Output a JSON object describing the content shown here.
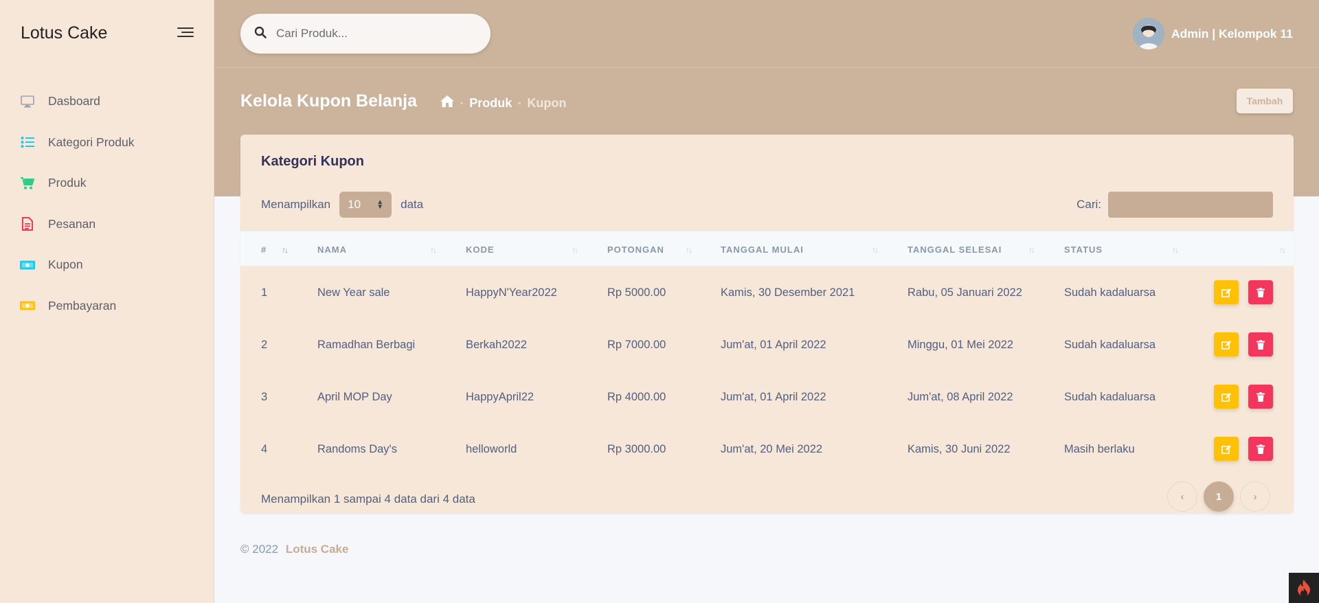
{
  "sidebar": {
    "brand": "Lotus Cake",
    "items": [
      {
        "label": "Dasboard",
        "icon": "monitor-icon",
        "color": "#8f9aa8"
      },
      {
        "label": "Kategori Produk",
        "icon": "list-icon",
        "color": "#11cdef"
      },
      {
        "label": "Produk",
        "icon": "cart-icon",
        "color": "#2dce89"
      },
      {
        "label": "Pesanan",
        "icon": "document-icon",
        "color": "#f5365c"
      },
      {
        "label": "Kupon",
        "icon": "money-icon",
        "color": "#11cdef"
      },
      {
        "label": "Pembayaran",
        "icon": "money-icon",
        "color": "#ffc107"
      }
    ]
  },
  "header": {
    "search_placeholder": "Cari Produk...",
    "user_name": "Admin | Kelompok 11",
    "page_title": "Kelola Kupon Belanja",
    "breadcrumb": [
      "Produk",
      "Kupon"
    ],
    "add_button": "Tambah"
  },
  "card": {
    "title": "Kategori Kupon",
    "show_prefix": "Menampilkan",
    "show_value": "10",
    "show_suffix": "data",
    "search_label": "Cari:",
    "columns": [
      "#",
      "NAMA",
      "KODE",
      "POTONGAN",
      "TANGGAL MULAI",
      "TANGGAL SELESAI",
      "STATUS"
    ],
    "rows": [
      {
        "no": "1",
        "nama": "New Year sale",
        "kode": "HappyN'Year2022",
        "potongan": "Rp 5000.00",
        "mulai": "Kamis, 30 Desember 2021",
        "selesai": "Rabu, 05 Januari 2022",
        "status": "Sudah kadaluarsa"
      },
      {
        "no": "2",
        "nama": "Ramadhan Berbagi",
        "kode": "Berkah2022",
        "potongan": "Rp 7000.00",
        "mulai": "Jum'at, 01 April 2022",
        "selesai": "Minggu, 01 Mei 2022",
        "status": "Sudah kadaluarsa"
      },
      {
        "no": "3",
        "nama": "April MOP Day",
        "kode": "HappyApril22",
        "potongan": "Rp 4000.00",
        "mulai": "Jum'at, 01 April 2022",
        "selesai": "Jum'at, 08 April 2022",
        "status": "Sudah kadaluarsa"
      },
      {
        "no": "4",
        "nama": "Randoms Day's",
        "kode": "helloworld",
        "potongan": "Rp 3000.00",
        "mulai": "Jum'at, 20 Mei 2022",
        "selesai": "Kamis, 30 Juni 2022",
        "status": "Masih berlaku"
      }
    ],
    "info": "Menampilkan 1 sampai 4 data dari 4 data",
    "pagination": {
      "prev": "‹",
      "current": "1",
      "next": "›"
    }
  },
  "footer": {
    "copyright": "© 2022",
    "brand": "Lotus Cake"
  },
  "colors": {
    "accent": "#cbb39c",
    "sidebar_bg": "#f7e7d9",
    "edit": "#ffc107",
    "delete": "#f5365c"
  }
}
